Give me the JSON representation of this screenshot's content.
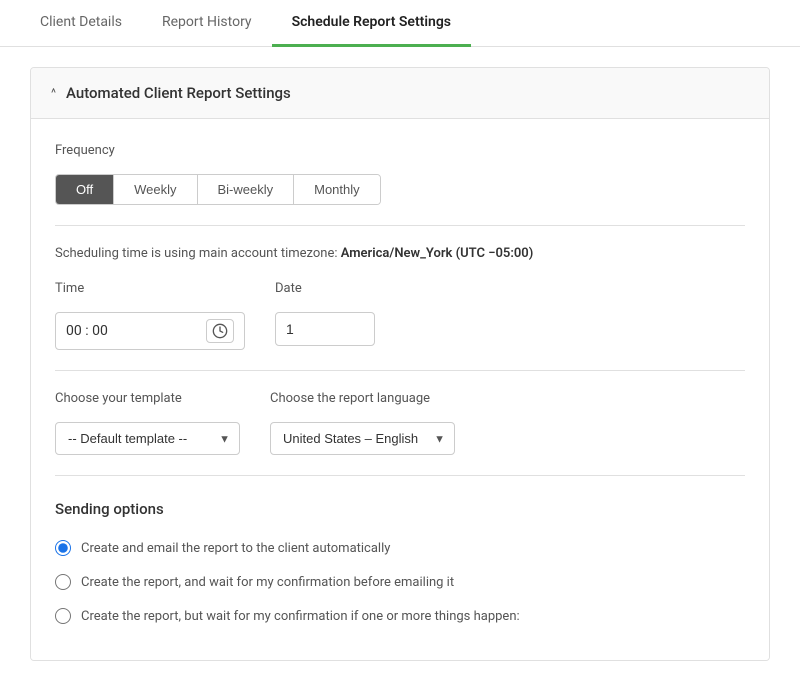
{
  "tabs": [
    {
      "id": "client-details",
      "label": "Client Details",
      "active": false
    },
    {
      "id": "report-history",
      "label": "Report History",
      "active": false
    },
    {
      "id": "schedule-report",
      "label": "Schedule Report Settings",
      "active": true
    }
  ],
  "section": {
    "title": "Automated Client Report Settings",
    "chevron": "^"
  },
  "frequency": {
    "label": "Frequency",
    "options": [
      {
        "id": "off",
        "label": "Off",
        "selected": true
      },
      {
        "id": "weekly",
        "label": "Weekly",
        "selected": false
      },
      {
        "id": "biweekly",
        "label": "Bi-weekly",
        "selected": false
      },
      {
        "id": "monthly",
        "label": "Monthly",
        "selected": false
      }
    ]
  },
  "timezone": {
    "note": "Scheduling time is using main account timezone:",
    "value": "America/New_York (UTC −05:00)"
  },
  "time_field": {
    "label": "Time",
    "value": "00 : 00",
    "clock_icon": "🕐"
  },
  "date_field": {
    "label": "Date",
    "value": "1"
  },
  "template": {
    "label": "Choose your template",
    "options": [
      {
        "value": "default",
        "label": "-- Default template --"
      }
    ],
    "selected": "-- Default template --"
  },
  "language": {
    "label": "Choose the report language",
    "options": [
      {
        "value": "en-us",
        "label": "United States – English"
      }
    ],
    "selected": "United States – English"
  },
  "sending_options": {
    "title": "Sending options",
    "options": [
      {
        "id": "auto",
        "label": "Create and email the report to the client automatically",
        "checked": true
      },
      {
        "id": "confirm-email",
        "label": "Create the report, and wait for my confirmation before emailing it",
        "checked": false
      },
      {
        "id": "confirm-condition",
        "label": "Create the report, but wait for my confirmation if one or more things happen:",
        "checked": false
      }
    ]
  }
}
